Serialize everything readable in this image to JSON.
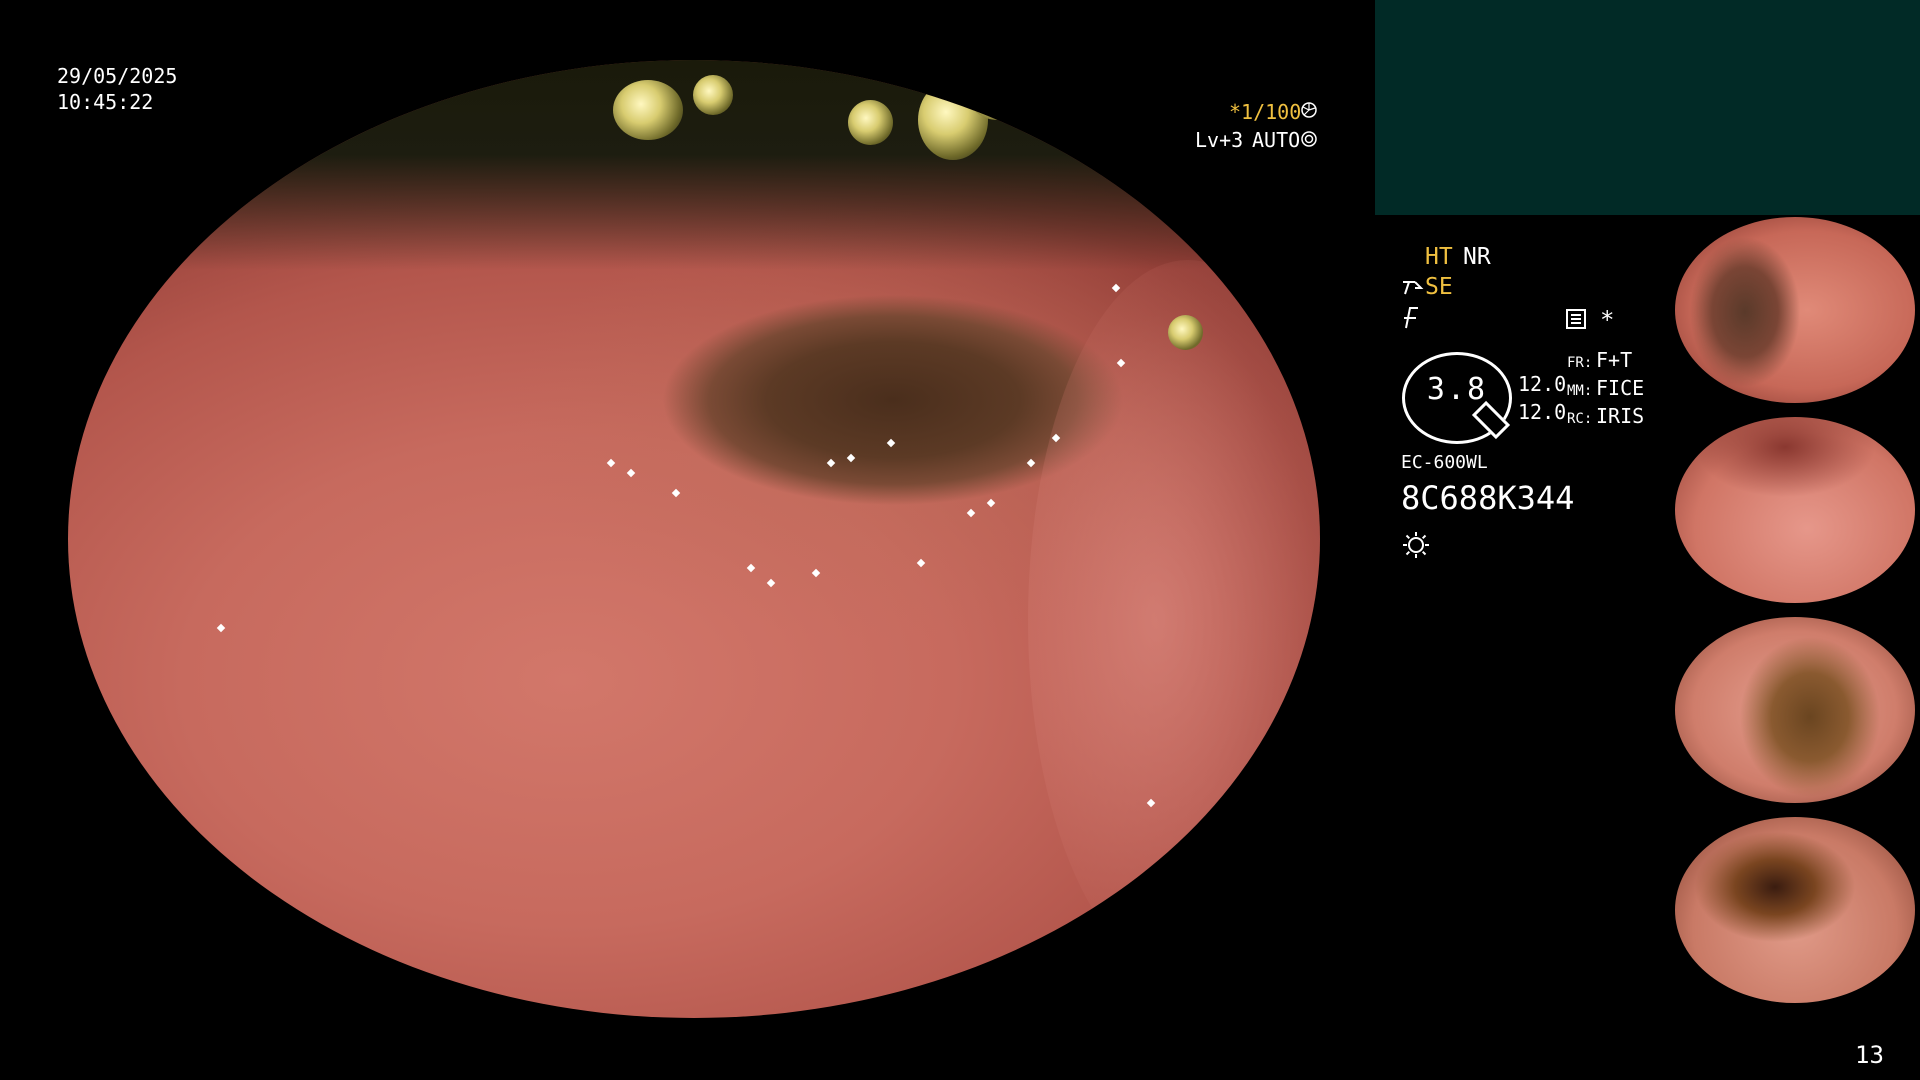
{
  "overlay": {
    "date": "29/05/2025",
    "time": "10:45:22",
    "shutter": "*1/100",
    "level": "Lv+3",
    "exposure_mode": "AUTO"
  },
  "settings": {
    "ht": "HT",
    "nr": "NR",
    "se": "SE",
    "mag_value": "3.8",
    "fr_key": "FR:",
    "fr_val": "F+T",
    "mm_key": "MM:",
    "mm_val": "FICE",
    "rc_key": "RC:",
    "rc_val": "IRIS",
    "val1": "12.0",
    "val2": "12.0",
    "scope_model": "EC-600WL",
    "serial": "8C688K344"
  },
  "page_number": "13",
  "icons": [
    "shutter-icon",
    "auto-icon",
    "se-icon",
    "light-icon",
    "record-icon",
    "sun-icon"
  ],
  "colors": {
    "accent_yellow": "#f0c040",
    "panel": "#012a26"
  }
}
